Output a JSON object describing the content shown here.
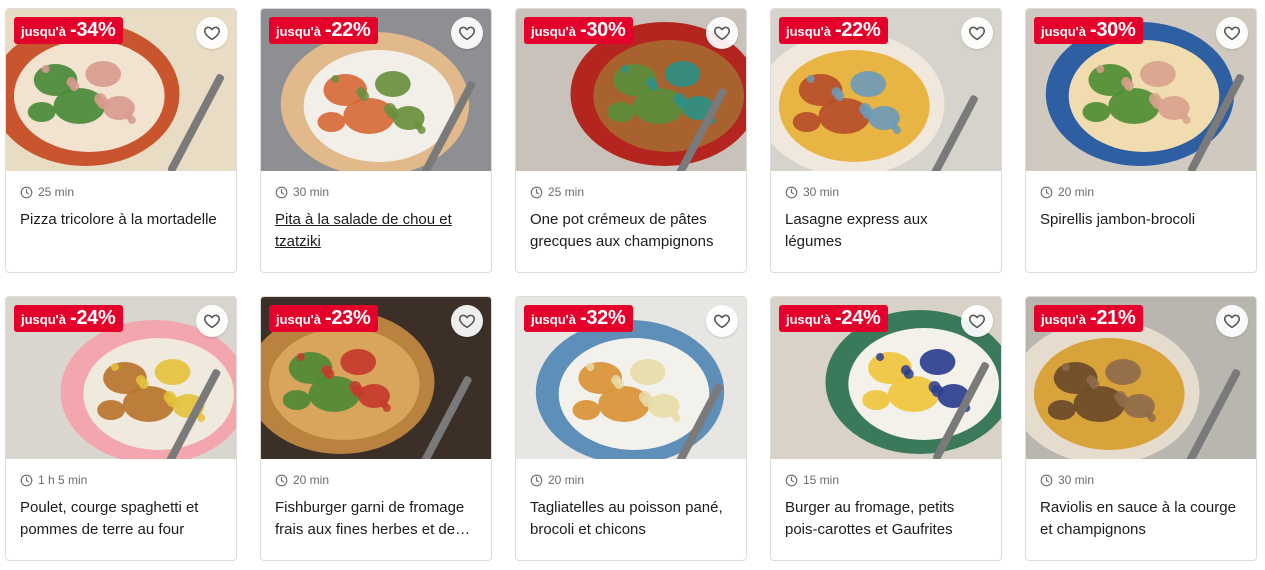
{
  "colors": {
    "promo_bg": "#e4002b",
    "promo_text": "#ffffff",
    "card_border": "#dcdcdc",
    "time_text": "#6b6b6b",
    "title_text": "#1c1c1c"
  },
  "icons": {
    "favorite": "heart-outline-icon",
    "time": "clock-icon"
  },
  "recipes": [
    {
      "promo_prefix": "jusqu'à",
      "promo_value": "-34%",
      "time": "25 min",
      "title": "Pizza tricolore à la mortadelle",
      "underlined": false,
      "palette": [
        "#e9dcc4",
        "#c8552e",
        "#f1e3cf",
        "#4a8a3a",
        "#d99b8f"
      ]
    },
    {
      "promo_prefix": "jusqu'à",
      "promo_value": "-22%",
      "time": "30 min",
      "title": "Pita à la salade de chou et tzatziki",
      "underlined": true,
      "palette": [
        "#8d8f92",
        "#e2b98a",
        "#f2efe8",
        "#d86a3a",
        "#6a8f3e"
      ]
    },
    {
      "promo_prefix": "jusqu'à",
      "promo_value": "-30%",
      "time": "25 min",
      "title": "One pot crémeux de pâtes grecques aux champignons",
      "underlined": false,
      "palette": [
        "#c9c2bb",
        "#b5251f",
        "#a8622e",
        "#5b8d3c",
        "#2f8f86"
      ]
    },
    {
      "promo_prefix": "jusqu'à",
      "promo_value": "-22%",
      "time": "30 min",
      "title": "Lasagne express aux légumes",
      "underlined": false,
      "palette": [
        "#d6d3cc",
        "#f0e8dc",
        "#e8b443",
        "#b74e2a",
        "#6c9bb8"
      ]
    },
    {
      "promo_prefix": "jusqu'à",
      "promo_value": "-30%",
      "time": "20 min",
      "title": "Spirellis jambon-brocoli",
      "underlined": false,
      "palette": [
        "#cfc9bf",
        "#2e5fa3",
        "#f0dcae",
        "#4f8d33",
        "#d9a28e"
      ]
    },
    {
      "promo_prefix": "jusqu'à",
      "promo_value": "-24%",
      "time": "1 h 5 min",
      "title": "Poulet, courge spaghetti et pommes de terre au four",
      "underlined": false,
      "palette": [
        "#d9d5cf",
        "#f3a6ad",
        "#f0e9dd",
        "#b8732c",
        "#e4c23b"
      ]
    },
    {
      "promo_prefix": "jusqu'à",
      "promo_value": "-23%",
      "time": "20 min",
      "title": "Fishburger garni de fromage frais aux fines herbes et de concombre",
      "underlined": false,
      "palette": [
        "#3b2f28",
        "#b9823f",
        "#d9a45b",
        "#4f8a35",
        "#c63a2e"
      ]
    },
    {
      "promo_prefix": "jusqu'à",
      "promo_value": "-32%",
      "time": "20 min",
      "title": "Tagliatelles au poisson pané, brocoli et chicons",
      "underlined": false,
      "palette": [
        "#e8e6e2",
        "#5d8fb8",
        "#f3f1ec",
        "#d99334",
        "#e8dca8"
      ]
    },
    {
      "promo_prefix": "jusqu'à",
      "promo_value": "-24%",
      "time": "15 min",
      "title": "Burger au fromage, petits pois-carottes et Gaufrites",
      "underlined": false,
      "palette": [
        "#d9d2c8",
        "#3a7a5a",
        "#f4f1ea",
        "#f0c53c",
        "#2c3e8f"
      ]
    },
    {
      "promo_prefix": "jusqu'à",
      "promo_value": "-21%",
      "time": "30 min",
      "title": "Raviolis en sauce à la courge et champignons",
      "underlined": false,
      "palette": [
        "#b9b6b0",
        "#e6dccd",
        "#d8a33a",
        "#6b4a2a",
        "#8f6b4a"
      ]
    }
  ]
}
